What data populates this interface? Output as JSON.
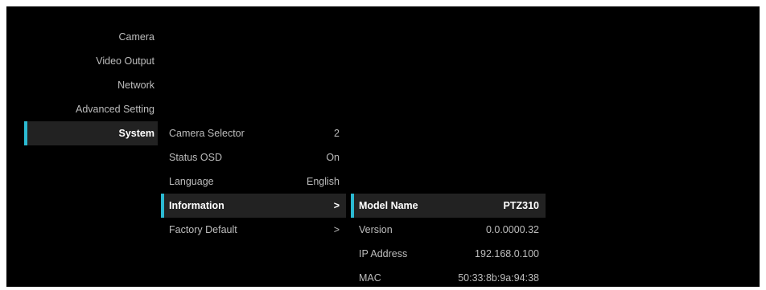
{
  "main_menu": {
    "items": [
      {
        "label": "Camera"
      },
      {
        "label": "Video Output"
      },
      {
        "label": "Network"
      },
      {
        "label": "Advanced Setting"
      },
      {
        "label": "System"
      }
    ],
    "selected": "System"
  },
  "system_menu": {
    "items": [
      {
        "label": "Camera Selector",
        "value": "2"
      },
      {
        "label": "Status OSD",
        "value": "On"
      },
      {
        "label": "Language",
        "value": "English"
      },
      {
        "label": "Information",
        "value": ">"
      },
      {
        "label": "Factory Default",
        "value": ">"
      }
    ],
    "selected": "Information"
  },
  "information": {
    "items": [
      {
        "label": "Model Name",
        "value": "PTZ310"
      },
      {
        "label": "Version",
        "value": "0.0.0000.32"
      },
      {
        "label": "IP Address",
        "value": "192.168.0.100"
      },
      {
        "label": "MAC",
        "value": "50:33:8b:9a:94:38"
      }
    ]
  },
  "colors": {
    "background": "#000000",
    "selected_row": "#222222",
    "accent": "#2bbad2",
    "text": "#bdbdbd",
    "selected_text": "#ffffff"
  }
}
